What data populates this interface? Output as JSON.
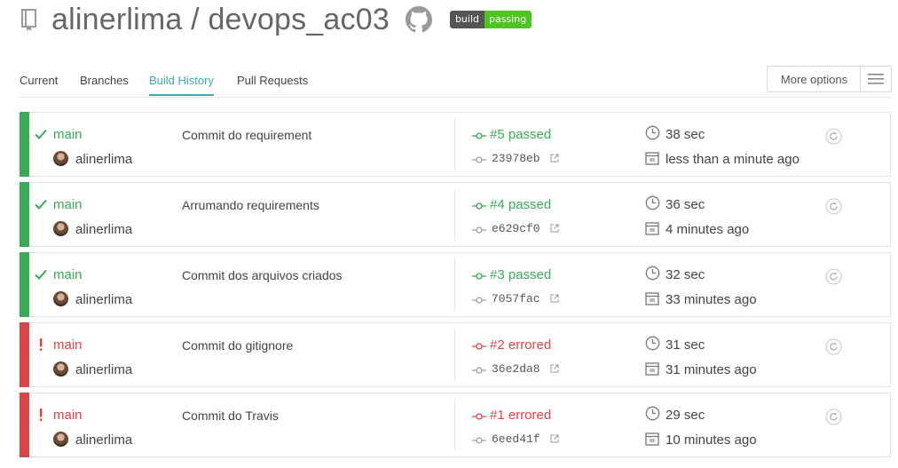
{
  "repo": {
    "owner": "alinerlima",
    "separator": " / ",
    "name": "devops_ac03",
    "badge_left": "build",
    "badge_right": "passing"
  },
  "tabs": [
    "Current",
    "Branches",
    "Build History",
    "Pull Requests"
  ],
  "active_tab": "Build History",
  "more_options_label": "More options",
  "colors": {
    "passed": "#39aa56",
    "errored": "#db4545",
    "accent": "#3eaaaf"
  },
  "builds": [
    {
      "status": "passed",
      "branch": "main",
      "author": "alinerlima",
      "message": "Commit do requirement",
      "build_label": "#5 passed",
      "sha": "23978eb",
      "duration": "38 sec",
      "finished": "less than a minute ago"
    },
    {
      "status": "passed",
      "branch": "main",
      "author": "alinerlima",
      "message": "Arrumando requirements",
      "build_label": "#4 passed",
      "sha": "e629cf0",
      "duration": "36 sec",
      "finished": "4 minutes ago"
    },
    {
      "status": "passed",
      "branch": "main",
      "author": "alinerlima",
      "message": "Commit dos arquivos criados",
      "build_label": "#3 passed",
      "sha": "7057fac",
      "duration": "32 sec",
      "finished": "33 minutes ago"
    },
    {
      "status": "errored",
      "branch": "main",
      "author": "alinerlima",
      "message": "Commit do gitignore",
      "build_label": "#2 errored",
      "sha": "36e2da8",
      "duration": "31 sec",
      "finished": "31 minutes ago"
    },
    {
      "status": "errored",
      "branch": "main",
      "author": "alinerlima",
      "message": "Commit do Travis",
      "build_label": "#1 errored",
      "sha": "6eed41f",
      "duration": "29 sec",
      "finished": "10 minutes ago"
    }
  ]
}
